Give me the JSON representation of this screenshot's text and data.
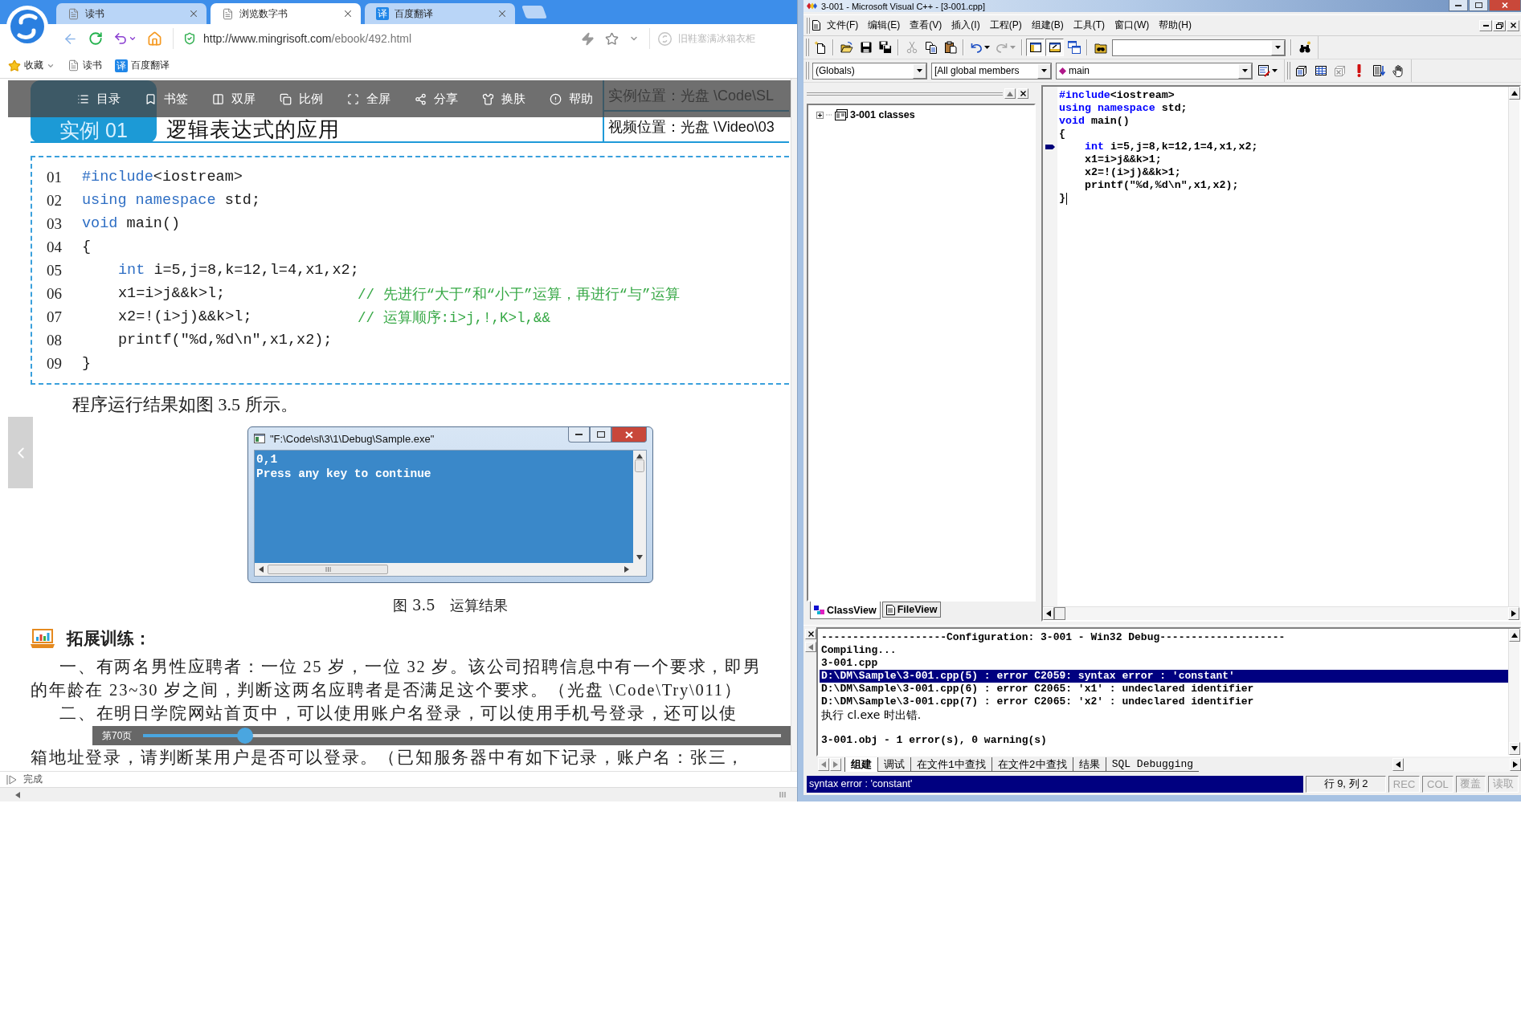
{
  "browser": {
    "tabs": [
      {
        "label": "读书",
        "kind": "page",
        "selected": false
      },
      {
        "label": "浏览数字书",
        "kind": "page",
        "selected": true
      },
      {
        "label": "百度翻译",
        "kind": "translate",
        "logo": "译",
        "selected": false
      }
    ],
    "address": {
      "host": "http://www.mingrisoft.com",
      "path": "/ebook/492.html"
    },
    "search": {
      "placeholder": "旧鞋塞满冰箱衣柜"
    },
    "bookmarks": [
      {
        "label": "收藏",
        "kind": "favorites"
      },
      {
        "label": "读书",
        "kind": "page"
      },
      {
        "label": "百度翻译",
        "kind": "translate",
        "logo": "译"
      }
    ],
    "status": "完成"
  },
  "ebook": {
    "toolbar": [
      {
        "label": "目录",
        "kind": "toc"
      },
      {
        "label": "书签",
        "kind": "bookmark"
      },
      {
        "label": "双屏",
        "kind": "dual"
      },
      {
        "label": "比例",
        "kind": "ratio"
      },
      {
        "label": "全屏",
        "kind": "fullscreen"
      },
      {
        "label": "分享",
        "kind": "share"
      },
      {
        "label": "换肤",
        "kind": "skin"
      },
      {
        "label": "帮助",
        "kind": "help"
      }
    ],
    "example_badge": "实例 01",
    "title": "逻辑表达式的应用",
    "locations": [
      "实例位置：光盘 \\Code\\SL",
      "视频位置：光盘 \\Video\\03"
    ],
    "code": [
      {
        "number": "01",
        "tokens": [
          {
            "text": "#include",
            "kind": "keyword"
          },
          {
            "text": "<iostream>",
            "kind": "plain"
          }
        ]
      },
      {
        "number": "02",
        "tokens": [
          {
            "text": "using namespace",
            "kind": "keyword"
          },
          {
            "text": " std;",
            "kind": "plain"
          }
        ]
      },
      {
        "number": "03",
        "tokens": [
          {
            "text": "void",
            "kind": "keyword"
          },
          {
            "text": " main()",
            "kind": "plain"
          }
        ]
      },
      {
        "number": "04",
        "tokens": [
          {
            "text": "{",
            "kind": "plain"
          }
        ],
        "children": [
          {
            "number": "05",
            "tokens": [
              {
                "text": "int",
                "kind": "keyword"
              },
              {
                "text": " i=5,j=8,k=12,l=4,x1,x2;",
                "kind": "plain"
              }
            ]
          },
          {
            "number": "06",
            "tokens": [
              {
                "text": "x1=i>j&&k>l;",
                "kind": "plain"
              }
            ],
            "comment": "// 先进行“大于”和“小于”运算，再进行“与”运算"
          },
          {
            "number": "07",
            "tokens": [
              {
                "text": "x2=!(i>j)&&k>l;",
                "kind": "plain"
              }
            ],
            "comment": "// 运算顺序:i>j,!,K>l,&&"
          },
          {
            "number": "08",
            "tokens": [
              {
                "text": "printf(\"%d,%d\\n\",x1,x2);",
                "kind": "plain"
              }
            ]
          }
        ]
      },
      {
        "number": "09",
        "tokens": [
          {
            "text": "}",
            "kind": "plain"
          }
        ]
      }
    ],
    "result_intro": "程序运行结果如图 3.5 所示。",
    "console": {
      "title": "\"F:\\Code\\sl\\3\\1\\Debug\\Sample.exe\"",
      "lines": [
        "0,1",
        "Press any key to continue"
      ]
    },
    "caption": {
      "number": "图 3.5",
      "text": "运算结果"
    },
    "exercise_heading": "拓展训练：",
    "paragraphs": [
      {
        "lines": [
          "一、有两名男性应聘者：一位 25 岁，一位 32 岁。该公司招聘信息中有一个要求，即男",
          "的年龄在 23~30 岁之间，判断这两名应聘者是否满足这个要求。（光盘 \\Code\\Try\\011）"
        ]
      },
      {
        "lines": [
          "二、在明日学院网站首页中，可以使用账户名登录，可以使用手机号登录，还可以使",
          "箱地址登录，请判断某用户是否可以登录。（已知服务器中有如下记录，账户名：张三，"
        ]
      }
    ],
    "page_bar": {
      "label": "第70页",
      "level": 0.16
    }
  },
  "vc": {
    "title": "3-001 - Microsoft Visual C++ - [3-001.cpp]",
    "menus": [
      "文件(F)",
      "编辑(E)",
      "查看(V)",
      "插入(I)",
      "工程(P)",
      "组建(B)",
      "工具(T)",
      "窗口(W)",
      "帮助(H)"
    ],
    "toolbar_rows": [
      {
        "bars": [
          {
            "groups": [
              {
                "items": [
                  {
                    "kind": "new",
                    "disabled": false,
                    "pressed": false
                  }
                ]
              },
              {
                "items": [
                  {
                    "kind": "open",
                    "disabled": false,
                    "pressed": false
                  },
                  {
                    "kind": "save",
                    "disabled": false,
                    "pressed": false
                  },
                  {
                    "kind": "save_all",
                    "disabled": false,
                    "pressed": false
                  }
                ]
              },
              {
                "items": [
                  {
                    "kind": "cut",
                    "disabled": true,
                    "pressed": false
                  },
                  {
                    "kind": "copy",
                    "disabled": false,
                    "pressed": false
                  },
                  {
                    "kind": "paste",
                    "disabled": false,
                    "pressed": false
                  }
                ]
              },
              {
                "items": [
                  {
                    "kind": "undo",
                    "disabled": false,
                    "pressed": false
                  },
                  {
                    "kind": "redo",
                    "disabled": true,
                    "pressed": false
                  }
                ]
              },
              {
                "items": [
                  {
                    "kind": "workspace",
                    "disabled": false,
                    "pressed": true
                  },
                  {
                    "kind": "output",
                    "disabled": false,
                    "pressed": true
                  },
                  {
                    "kind": "window_list",
                    "disabled": false,
                    "pressed": false
                  }
                ]
              },
              {
                "items": [
                  {
                    "kind": "find_in_files",
                    "disabled": false,
                    "pressed": false
                  },
                  {
                    "kind": "find_combo",
                    "disabled": false,
                    "pressed": false
                  }
                ]
              },
              {
                "items": [
                  {
                    "kind": "find",
                    "disabled": false,
                    "pressed": false
                  }
                ]
              }
            ]
          }
        ]
      },
      {
        "bars": [
          {
            "groups": [
              {
                "items": [
                  {
                    "kind": "scope_combo",
                    "value": "(Globals)",
                    "disabled": false,
                    "pressed": false
                  },
                  {
                    "kind": "filter_combo",
                    "value": "[All global members",
                    "disabled": false,
                    "pressed": false
                  },
                  {
                    "kind": "member_combo",
                    "value": "main",
                    "disabled": false,
                    "pressed": false
                  },
                  {
                    "kind": "wizard",
                    "disabled": false,
                    "pressed": false
                  }
                ]
              }
            ]
          },
          {
            "groups": [
              {
                "items": [
                  {
                    "kind": "compile",
                    "disabled": false,
                    "pressed": false
                  },
                  {
                    "kind": "build",
                    "disabled": false,
                    "pressed": false
                  },
                  {
                    "kind": "stop_build",
                    "disabled": true,
                    "pressed": false
                  },
                  {
                    "kind": "execute",
                    "disabled": false,
                    "pressed": false
                  },
                  {
                    "kind": "go",
                    "disabled": false,
                    "pressed": false
                  },
                  {
                    "kind": "breakpoint",
                    "disabled": false,
                    "pressed": false
                  }
                ]
              }
            ]
          }
        ]
      }
    ],
    "workspace": {
      "tree": [
        {
          "label": "3-001 classes",
          "expanded": false
        }
      ],
      "tabs": [
        {
          "label": "ClassView",
          "kind": "class",
          "selected": true
        },
        {
          "label": "FileView",
          "kind": "file",
          "selected": false
        }
      ]
    },
    "editor": {
      "lines": [
        {
          "marked": false,
          "cursor": false,
          "tokens": [
            {
              "text": "#include",
              "kind": "keyword"
            },
            {
              "text": "<iostream>",
              "kind": "plain"
            }
          ]
        },
        {
          "marked": false,
          "cursor": false,
          "tokens": [
            {
              "text": "using namespace",
              "kind": "keyword"
            },
            {
              "text": " std;",
              "kind": "plain"
            }
          ]
        },
        {
          "marked": false,
          "cursor": false,
          "tokens": [
            {
              "text": "void",
              "kind": "keyword"
            },
            {
              "text": " main()",
              "kind": "plain"
            }
          ]
        },
        {
          "marked": false,
          "cursor": false,
          "tokens": [
            {
              "text": "{",
              "kind": "plain"
            }
          ],
          "children": [
            {
              "marked": true,
              "cursor": false,
              "tokens": [
                {
                  "text": "int",
                  "kind": "keyword"
                },
                {
                  "text": " i=5,j=8,k=12,1=4,x1,x2;",
                  "kind": "plain"
                }
              ]
            },
            {
              "marked": false,
              "cursor": false,
              "tokens": [
                {
                  "text": "x1=i>j&&k>1;",
                  "kind": "plain"
                }
              ]
            },
            {
              "marked": false,
              "cursor": false,
              "tokens": [
                {
                  "text": "x2=!(i>j)&&k>1;",
                  "kind": "plain"
                }
              ]
            },
            {
              "marked": false,
              "cursor": false,
              "tokens": [
                {
                  "text": "printf(\"%d,%d\\n\",x1,x2);",
                  "kind": "plain"
                }
              ]
            }
          ]
        },
        {
          "marked": false,
          "cursor": true,
          "tokens": [
            {
              "text": "}",
              "kind": "plain"
            }
          ]
        }
      ]
    },
    "output": {
      "lines": [
        {
          "text": "--------------------Configuration: 3-001 - Win32 Debug--------------------",
          "kind": "log",
          "selected": false
        },
        {
          "text": "Compiling...",
          "kind": "log",
          "selected": false
        },
        {
          "text": "3-001.cpp",
          "kind": "log",
          "selected": false
        },
        {
          "text": "D:\\DM\\Sample\\3-001.cpp(5) : error C2059: syntax error : 'constant'",
          "kind": "log",
          "selected": true
        },
        {
          "text": "D:\\DM\\Sample\\3-001.cpp(6) : error C2065: 'x1' : undeclared identifier",
          "kind": "log",
          "selected": false
        },
        {
          "text": "D:\\DM\\Sample\\3-001.cpp(7) : error C2065: 'x2' : undeclared identifier",
          "kind": "log",
          "selected": false
        },
        {
          "text": "执行 cl.exe 时出错.",
          "kind": "note",
          "selected": false
        },
        {
          "text": "3-001.obj - 1 error(s), 0 warning(s)",
          "kind": "summary",
          "selected": false
        }
      ],
      "tabs": [
        {
          "label": "组建",
          "selected": true
        },
        {
          "label": "调试",
          "selected": false
        },
        {
          "label": "在文件1中查找",
          "selected": false
        },
        {
          "label": "在文件2中查找",
          "selected": false
        },
        {
          "label": "结果",
          "selected": false
        },
        {
          "label": "SQL Debugging",
          "selected": false
        }
      ]
    },
    "status": {
      "message": "syntax error : 'constant'",
      "position": "行 9, 列 2",
      "indicators": [
        {
          "label": "REC",
          "active": false
        },
        {
          "label": "COL",
          "active": false
        },
        {
          "label": "覆盖",
          "active": false
        },
        {
          "label": "读取",
          "active": false
        }
      ]
    }
  }
}
